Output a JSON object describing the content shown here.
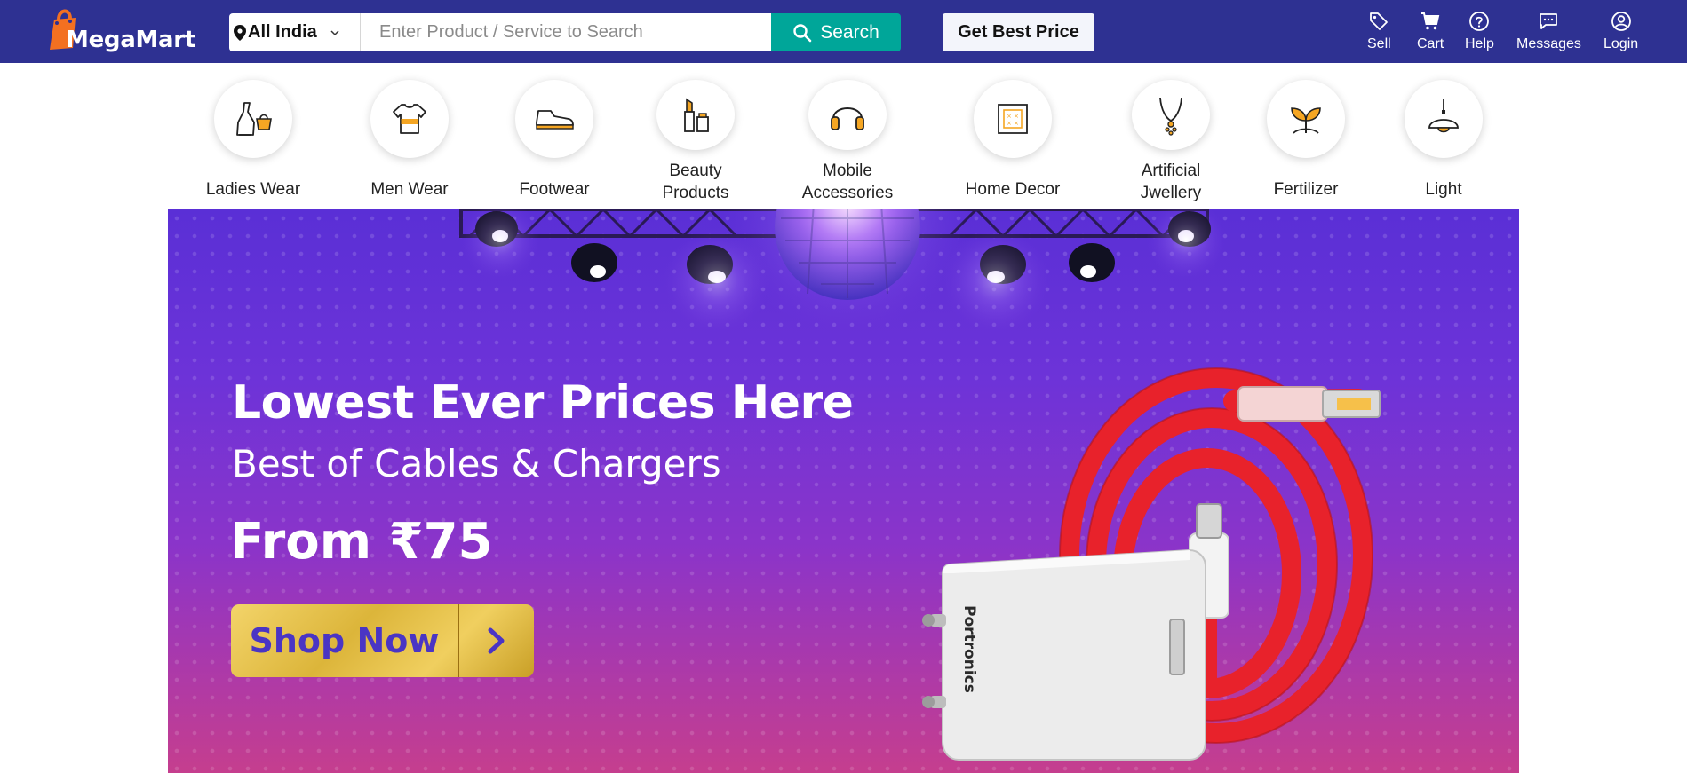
{
  "header": {
    "brand": "MegaMart",
    "location": "All India",
    "search_placeholder": "Enter Product / Service to Search",
    "search_label": "Search",
    "best_price_label": "Get Best Price",
    "nav": [
      {
        "label": "Sell",
        "icon": "tag-icon"
      },
      {
        "label": "Cart",
        "icon": "cart-icon"
      },
      {
        "label": "Help",
        "icon": "help-icon"
      },
      {
        "label": "Messages",
        "icon": "message-icon"
      },
      {
        "label": "Login",
        "icon": "user-icon"
      }
    ]
  },
  "categories": [
    {
      "label": "Ladies Wear",
      "icon": "dress-icon"
    },
    {
      "label": "Men Wear",
      "icon": "tshirt-icon"
    },
    {
      "label": "Footwear",
      "icon": "shoe-icon"
    },
    {
      "label": "Beauty\nProducts",
      "icon": "lipstick-icon"
    },
    {
      "label": "Mobile\nAccessories",
      "icon": "headphones-icon"
    },
    {
      "label": "Home Decor",
      "icon": "cushion-icon"
    },
    {
      "label": "Artificial\nJwellery",
      "icon": "necklace-icon"
    },
    {
      "label": "Fertilizer",
      "icon": "plant-icon"
    },
    {
      "label": "Light",
      "icon": "lamp-icon"
    }
  ],
  "banner": {
    "title": "Lowest Ever Prices Here",
    "subtitle": "Best of Cables & Chargers",
    "price": "From ₹75",
    "cta_label": "Shop Now",
    "charger_brand": "Portronics"
  },
  "colors": {
    "header_bg": "#2e3192",
    "search_button": "#00a699",
    "logo_orange": "#f37021",
    "category_icon_accent": "#f5a623",
    "banner_purple": "#6d33d8",
    "cable_red": "#e8222b",
    "cta_gold": "#e3c14a",
    "cta_text": "#4a35c4"
  }
}
